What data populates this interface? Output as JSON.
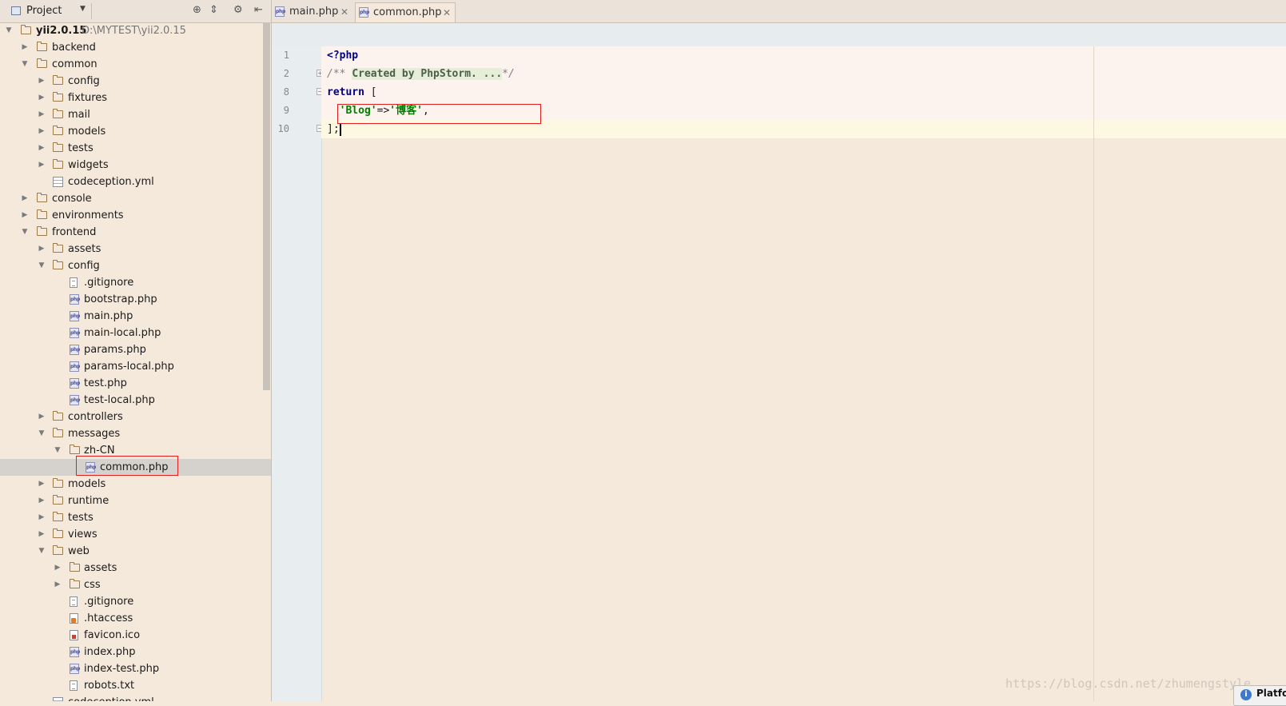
{
  "project_panel": {
    "title": "Project",
    "root_label": "yii2.0.15",
    "root_path": "D:\\MYTEST\\yii2.0.15",
    "items": [
      "backend",
      "common",
      "config",
      "fixtures",
      "mail",
      "models",
      "tests",
      "widgets",
      "codeception.yml",
      "console",
      "environments",
      "frontend",
      "assets",
      "config",
      ".gitignore",
      "bootstrap.php",
      "main.php",
      "main-local.php",
      "params.php",
      "params-local.php",
      "test.php",
      "test-local.php",
      "controllers",
      "messages",
      "zh-CN",
      "common.php",
      "models",
      "runtime",
      "tests",
      "views",
      "web",
      "assets",
      "css",
      ".gitignore",
      ".htaccess",
      "favicon.ico",
      "index.php",
      "index-test.php",
      "robots.txt",
      "codeception.yml"
    ]
  },
  "tabs": [
    {
      "label": "main.php"
    },
    {
      "label": "common.php"
    }
  ],
  "editor": {
    "line_numbers": [
      "1",
      "2",
      "8",
      "9",
      "10"
    ],
    "code": {
      "l1": "<?php",
      "l2_prefix": "/** ",
      "l2_fold": "Created by PhpStorm. ...",
      "l2_suffix": "*/",
      "l3_kw": "return",
      "l3_rest": " [",
      "l4_indent": "  ",
      "l4_key": "'Blog'",
      "l4_op": "=>",
      "l4_val": "'博客'",
      "l4_end": ",",
      "l5": "];"
    }
  },
  "watermark": "https://blog.csdn.net/zhumengstyle",
  "notification": {
    "icon": "i",
    "label": "Platfo"
  },
  "icons": {
    "php_badge": "php"
  }
}
